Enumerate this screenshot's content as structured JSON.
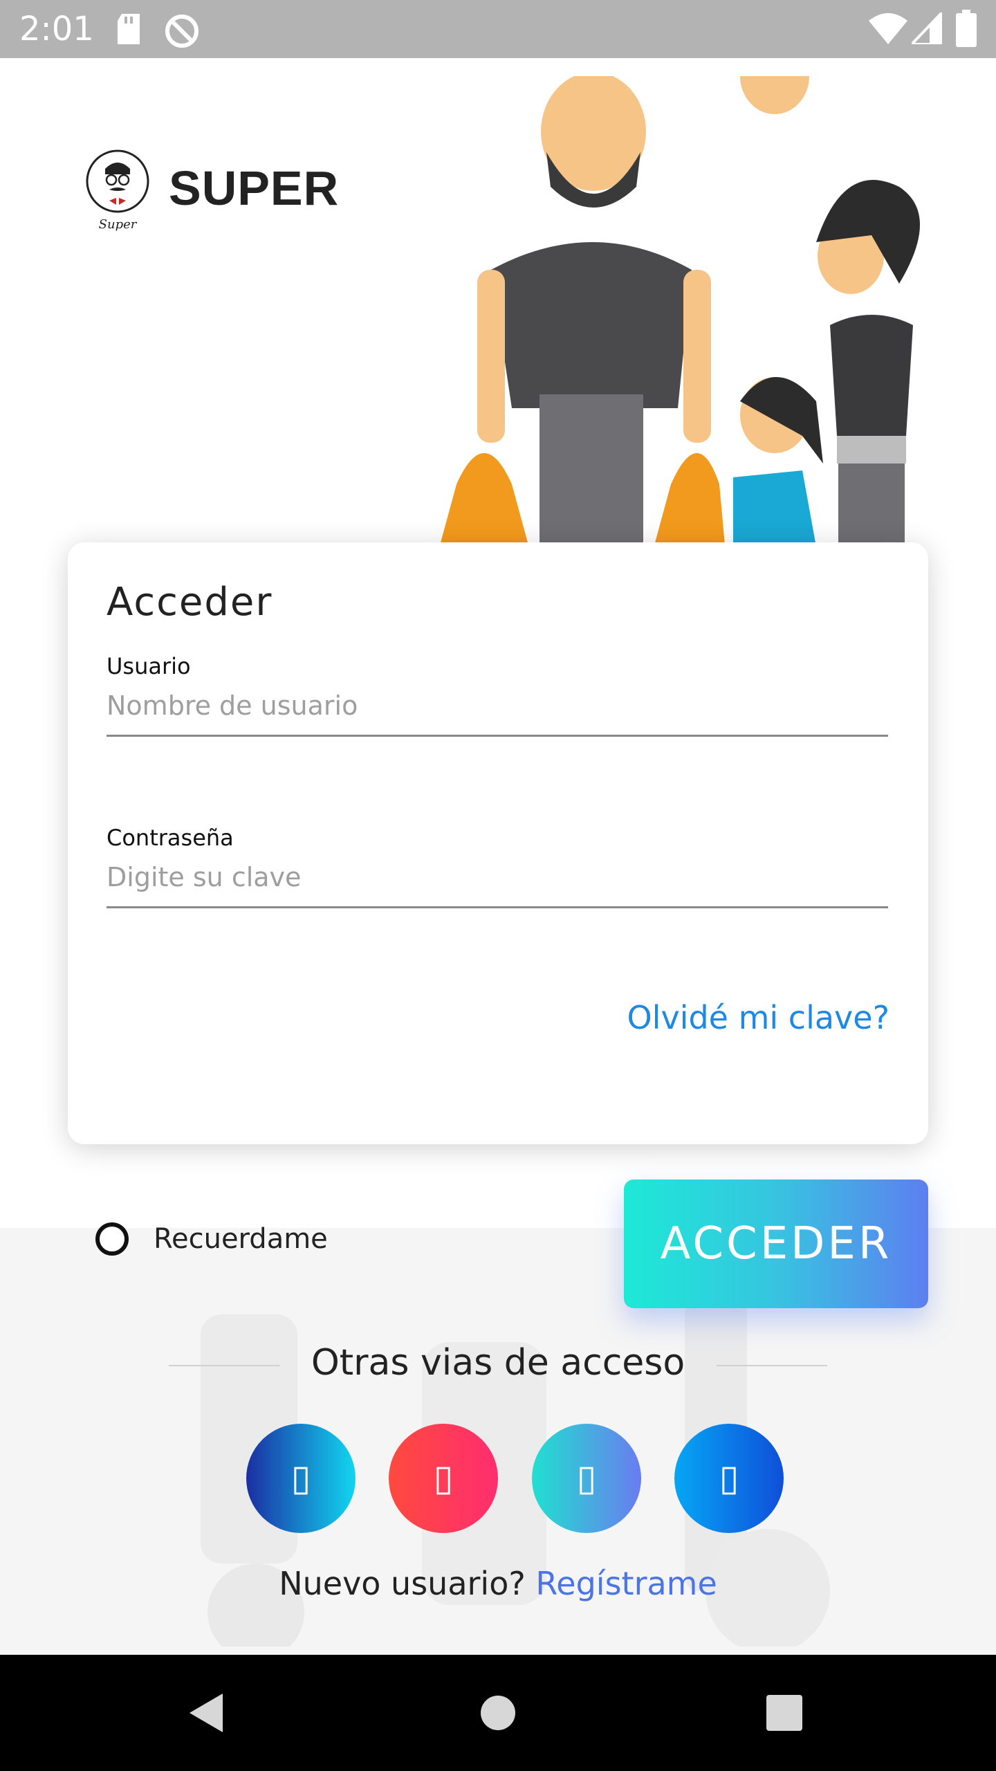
{
  "status_bar": {
    "time": "2:01"
  },
  "header": {
    "brand": "SUPER",
    "logo_caption": "Super"
  },
  "login_card": {
    "title": "Acceder",
    "username_label": "Usuario",
    "username_placeholder": "Nombre de usuario",
    "password_label": "Contraseña",
    "password_placeholder": "Digite su clave",
    "forgot_link": "Olvidé mi clave?"
  },
  "remember": {
    "label": "Recuerdame",
    "checked": false
  },
  "login_button": {
    "label": "ACCEDER"
  },
  "other_access": {
    "title": "Otras vias de acceso",
    "buttons": [
      {
        "icon": "social-login-icon-1",
        "glyph": "▯"
      },
      {
        "icon": "social-login-icon-2",
        "glyph": "▯"
      },
      {
        "icon": "social-login-icon-3",
        "glyph": "▯"
      },
      {
        "icon": "social-login-icon-4",
        "glyph": "▯"
      }
    ]
  },
  "register": {
    "prompt": "Nuevo usuario?",
    "link": "Regístrame"
  },
  "colors": {
    "accent": "#1e88e5",
    "link": "#4a74e8",
    "button_start": "#1de9d6",
    "button_end": "#5d7ff0"
  }
}
